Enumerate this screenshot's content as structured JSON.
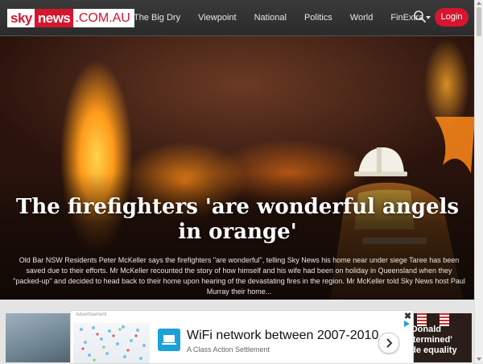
{
  "brand": {
    "sky": "sky",
    "news": "news",
    "domain": ".COM.AU",
    "red": "#d5162e"
  },
  "nav": {
    "items": [
      "The Big Dry",
      "Viewpoint",
      "National",
      "Politics",
      "World"
    ],
    "more_label": "FinExtra",
    "more_icon": "chevron-down-icon",
    "search_icon": "search-icon",
    "login_label": "Login"
  },
  "hero": {
    "title": "The firefighters 'are wonderful angels in orange'",
    "summary": "Old Bar NSW Residents Peter McKeller says the firefighters \"are wonderful\", telling Sky News his home near under siege Taree has been saved due to their efforts. Mr McKeller recounted the story of how himself and his wife had been on holiday in Queensland when they \"packed-up\" and decided to head back to their home upon hearing of the devastating fires in the region. Mr McKeller told Sky News host Paul Murray their home..."
  },
  "ad": {
    "label": "Advertisement",
    "close": "✖",
    "headline": "WiFi network between 2007-2010",
    "sub": "A Class Action Settlement",
    "arrow_icon": "chevron-right-icon"
  },
  "right_thumb": {
    "text": "t Donald\n'etermined'\nade equality"
  }
}
